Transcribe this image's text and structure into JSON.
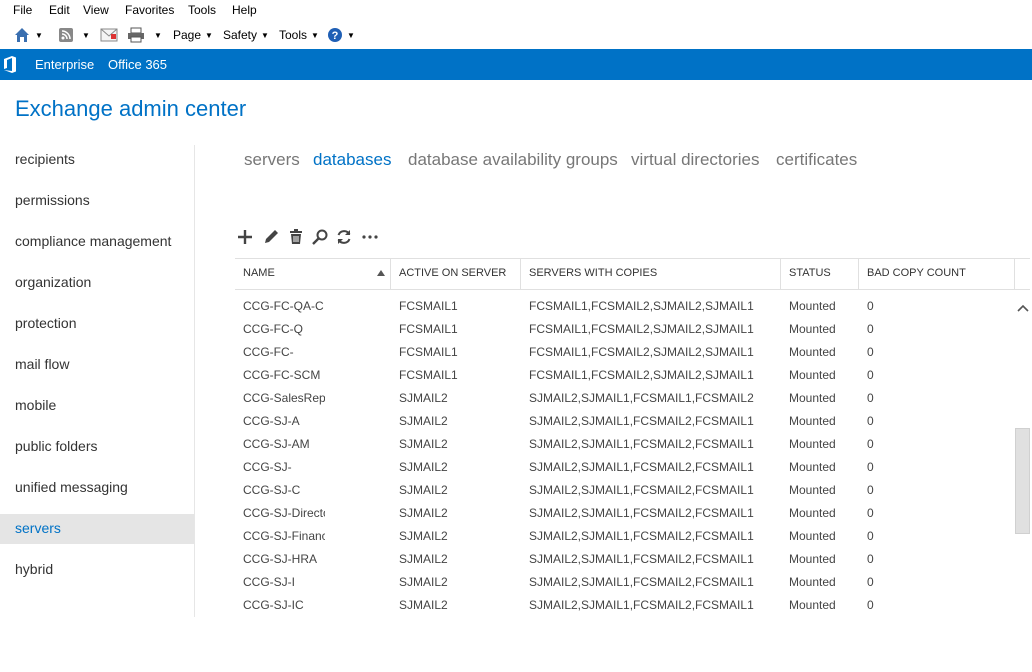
{
  "menu": {
    "file": "File",
    "edit": "Edit",
    "view": "View",
    "favorites": "Favorites",
    "tools": "Tools",
    "help": "Help"
  },
  "ie_toolbar": {
    "page": "Page",
    "safety": "Safety",
    "tools": "Tools"
  },
  "topbar": {
    "enterprise": "Enterprise",
    "office365": "Office 365"
  },
  "app_title": "Exchange admin center",
  "nav": [
    {
      "label": "recipients"
    },
    {
      "label": "permissions"
    },
    {
      "label": "compliance management"
    },
    {
      "label": "organization"
    },
    {
      "label": "protection"
    },
    {
      "label": "mail flow"
    },
    {
      "label": "mobile"
    },
    {
      "label": "public folders"
    },
    {
      "label": "unified messaging"
    },
    {
      "label": "servers"
    },
    {
      "label": "hybrid"
    }
  ],
  "nav_selected": "servers",
  "tabs": [
    {
      "label": "servers"
    },
    {
      "label": "databases"
    },
    {
      "label": "database availability groups"
    },
    {
      "label": "virtual directories"
    },
    {
      "label": "certificates"
    }
  ],
  "tab_selected": "databases",
  "actions": [
    "add-icon",
    "edit-icon",
    "delete-icon",
    "search-icon",
    "refresh-icon",
    "more-icon"
  ],
  "columns": {
    "name": "NAME",
    "active_on_server": "ACTIVE ON SERVER",
    "servers_with_copies": "SERVERS WITH COPIES",
    "status": "STATUS",
    "bad_copy_count": "BAD COPY COUNT"
  },
  "sort": {
    "column": "NAME",
    "direction": "ascending"
  },
  "rows": [
    {
      "name": "CCG-FC-QA-C",
      "server": "FCSMAIL1",
      "copies": "FCSMAIL1,FCSMAIL2,SJMAIL2,SJMAIL1",
      "status": "Mounted",
      "bad": "0"
    },
    {
      "name": "CCG-FC-Q",
      "server": "FCSMAIL1",
      "copies": "FCSMAIL1,FCSMAIL2,SJMAIL2,SJMAIL1",
      "status": "Mounted",
      "bad": "0"
    },
    {
      "name": "CCG-FC-",
      "server": "FCSMAIL1",
      "copies": "FCSMAIL1,FCSMAIL2,SJMAIL2,SJMAIL1",
      "status": "Mounted",
      "bad": "0"
    },
    {
      "name": "CCG-FC-SCM",
      "server": "FCSMAIL1",
      "copies": "FCSMAIL1,FCSMAIL2,SJMAIL2,SJMAIL1",
      "status": "Mounted",
      "bad": "0"
    },
    {
      "name": "CCG-SalesRep",
      "server": "SJMAIL2",
      "copies": "SJMAIL2,SJMAIL1,FCSMAIL1,FCSMAIL2",
      "status": "Mounted",
      "bad": "0"
    },
    {
      "name": "CCG-SJ-A",
      "server": "SJMAIL2",
      "copies": "SJMAIL2,SJMAIL1,FCSMAIL2,FCSMAIL1",
      "status": "Mounted",
      "bad": "0"
    },
    {
      "name": "CCG-SJ-AM",
      "server": "SJMAIL2",
      "copies": "SJMAIL2,SJMAIL1,FCSMAIL2,FCSMAIL1",
      "status": "Mounted",
      "bad": "0"
    },
    {
      "name": "CCG-SJ-",
      "server": "SJMAIL2",
      "copies": "SJMAIL2,SJMAIL1,FCSMAIL2,FCSMAIL1",
      "status": "Mounted",
      "bad": "0"
    },
    {
      "name": "CCG-SJ-C",
      "server": "SJMAIL2",
      "copies": "SJMAIL2,SJMAIL1,FCSMAIL2,FCSMAIL1",
      "status": "Mounted",
      "bad": "0"
    },
    {
      "name": "CCG-SJ-Director",
      "server": "SJMAIL2",
      "copies": "SJMAIL2,SJMAIL1,FCSMAIL2,FCSMAIL1",
      "status": "Mounted",
      "bad": "0"
    },
    {
      "name": "CCG-SJ-Finance",
      "server": "SJMAIL2",
      "copies": "SJMAIL2,SJMAIL1,FCSMAIL2,FCSMAIL1",
      "status": "Mounted",
      "bad": "0"
    },
    {
      "name": "CCG-SJ-HRA",
      "server": "SJMAIL2",
      "copies": "SJMAIL2,SJMAIL1,FCSMAIL2,FCSMAIL1",
      "status": "Mounted",
      "bad": "0"
    },
    {
      "name": "CCG-SJ-I",
      "server": "SJMAIL2",
      "copies": "SJMAIL2,SJMAIL1,FCSMAIL2,FCSMAIL1",
      "status": "Mounted",
      "bad": "0"
    },
    {
      "name": "CCG-SJ-IC",
      "server": "SJMAIL2",
      "copies": "SJMAIL2,SJMAIL1,FCSMAIL2,FCSMAIL1",
      "status": "Mounted",
      "bad": "0"
    }
  ],
  "colors": {
    "brand": "#0072c6",
    "nav_selected_bg": "#e5e5e5",
    "text": "#333333",
    "tab_inactive": "#777777"
  }
}
